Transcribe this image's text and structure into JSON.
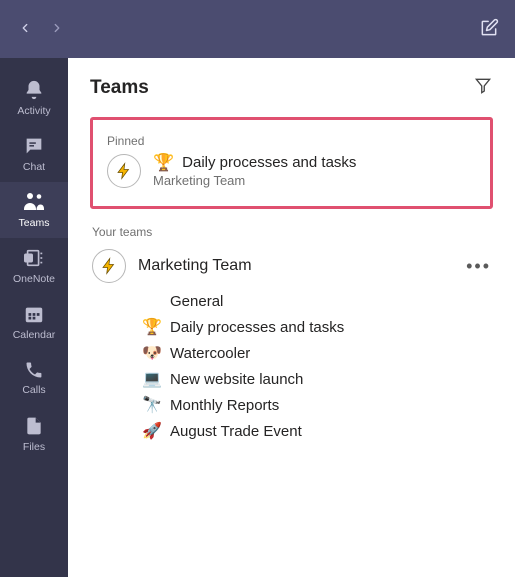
{
  "titlebar": {},
  "rail": {
    "activity": "Activity",
    "chat": "Chat",
    "teams": "Teams",
    "onenote": "OneNote",
    "calendar": "Calendar",
    "calls": "Calls",
    "files": "Files"
  },
  "header": {
    "title": "Teams"
  },
  "pinned": {
    "section_label": "Pinned",
    "item": {
      "icon": "🏆",
      "title": "Daily processes and tasks",
      "subtitle": "Marketing Team"
    }
  },
  "your_teams": {
    "section_label": "Your teams",
    "team": {
      "name": "Marketing Team",
      "channels": [
        {
          "icon": "",
          "name": "General"
        },
        {
          "icon": "🏆",
          "name": "Daily processes and tasks"
        },
        {
          "icon": "🐶",
          "name": "Watercooler"
        },
        {
          "icon": "💻",
          "name": "New website launch"
        },
        {
          "icon": "🔭",
          "name": "Monthly Reports"
        },
        {
          "icon": "🚀",
          "name": "August Trade Event"
        }
      ]
    }
  }
}
